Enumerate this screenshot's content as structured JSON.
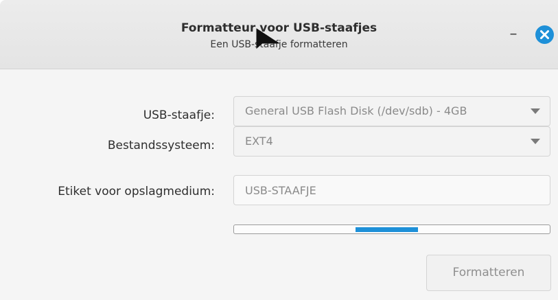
{
  "window": {
    "title": "Formatteur voor USB-staafjes",
    "subtitle": "Een USB-staafje formatteren",
    "minimize_label": "–"
  },
  "form": {
    "usb_label": "USB-staafje:",
    "usb_value": "General USB Flash Disk (/dev/sdb) - 4GB",
    "fs_label": "Bestandssysteem:",
    "fs_value": "EXT4",
    "volume_label": "Etiket voor opslagmedium:",
    "volume_value": "USB-STAAFJE"
  },
  "progress": {
    "mode": "indeterminate (pulsing)"
  },
  "actions": {
    "format_label": "Formatteren"
  },
  "colors": {
    "accent": "#1e90d8",
    "titlebar": "#e7e7e7",
    "background": "#f5f5f5",
    "disabled_text": "#8a8a8a"
  },
  "icons": {
    "close": "close-circle-icon",
    "minimize": "minimize-icon",
    "dropdown": "chevron-down-icon",
    "pointer": "mouse-pointer-icon"
  }
}
